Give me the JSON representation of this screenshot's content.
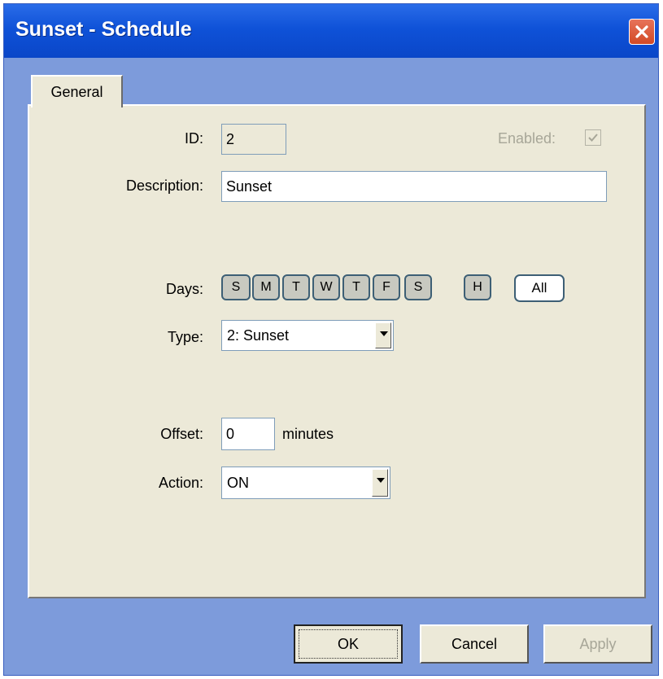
{
  "window": {
    "title": "Sunset - Schedule"
  },
  "tabs": [
    {
      "label": "General"
    }
  ],
  "form": {
    "id_label": "ID:",
    "id_value": "2",
    "enabled_label": "Enabled:",
    "enabled_checked": true,
    "description_label": "Description:",
    "description_value": "Sunset",
    "days_label": "Days:",
    "days": [
      "S",
      "M",
      "T",
      "W",
      "T",
      "F",
      "S",
      "H"
    ],
    "all_label": "All",
    "type_label": "Type:",
    "type_value": "2: Sunset",
    "offset_label": "Offset:",
    "offset_value": "0",
    "offset_units": "minutes",
    "action_label": "Action:",
    "action_value": "ON"
  },
  "buttons": {
    "ok": "OK",
    "cancel": "Cancel",
    "apply": "Apply"
  },
  "colors": {
    "titlebar": "#0f52d8",
    "window_frame": "#7d9bdb",
    "panel": "#ece9d8",
    "close": "#d34a25"
  }
}
